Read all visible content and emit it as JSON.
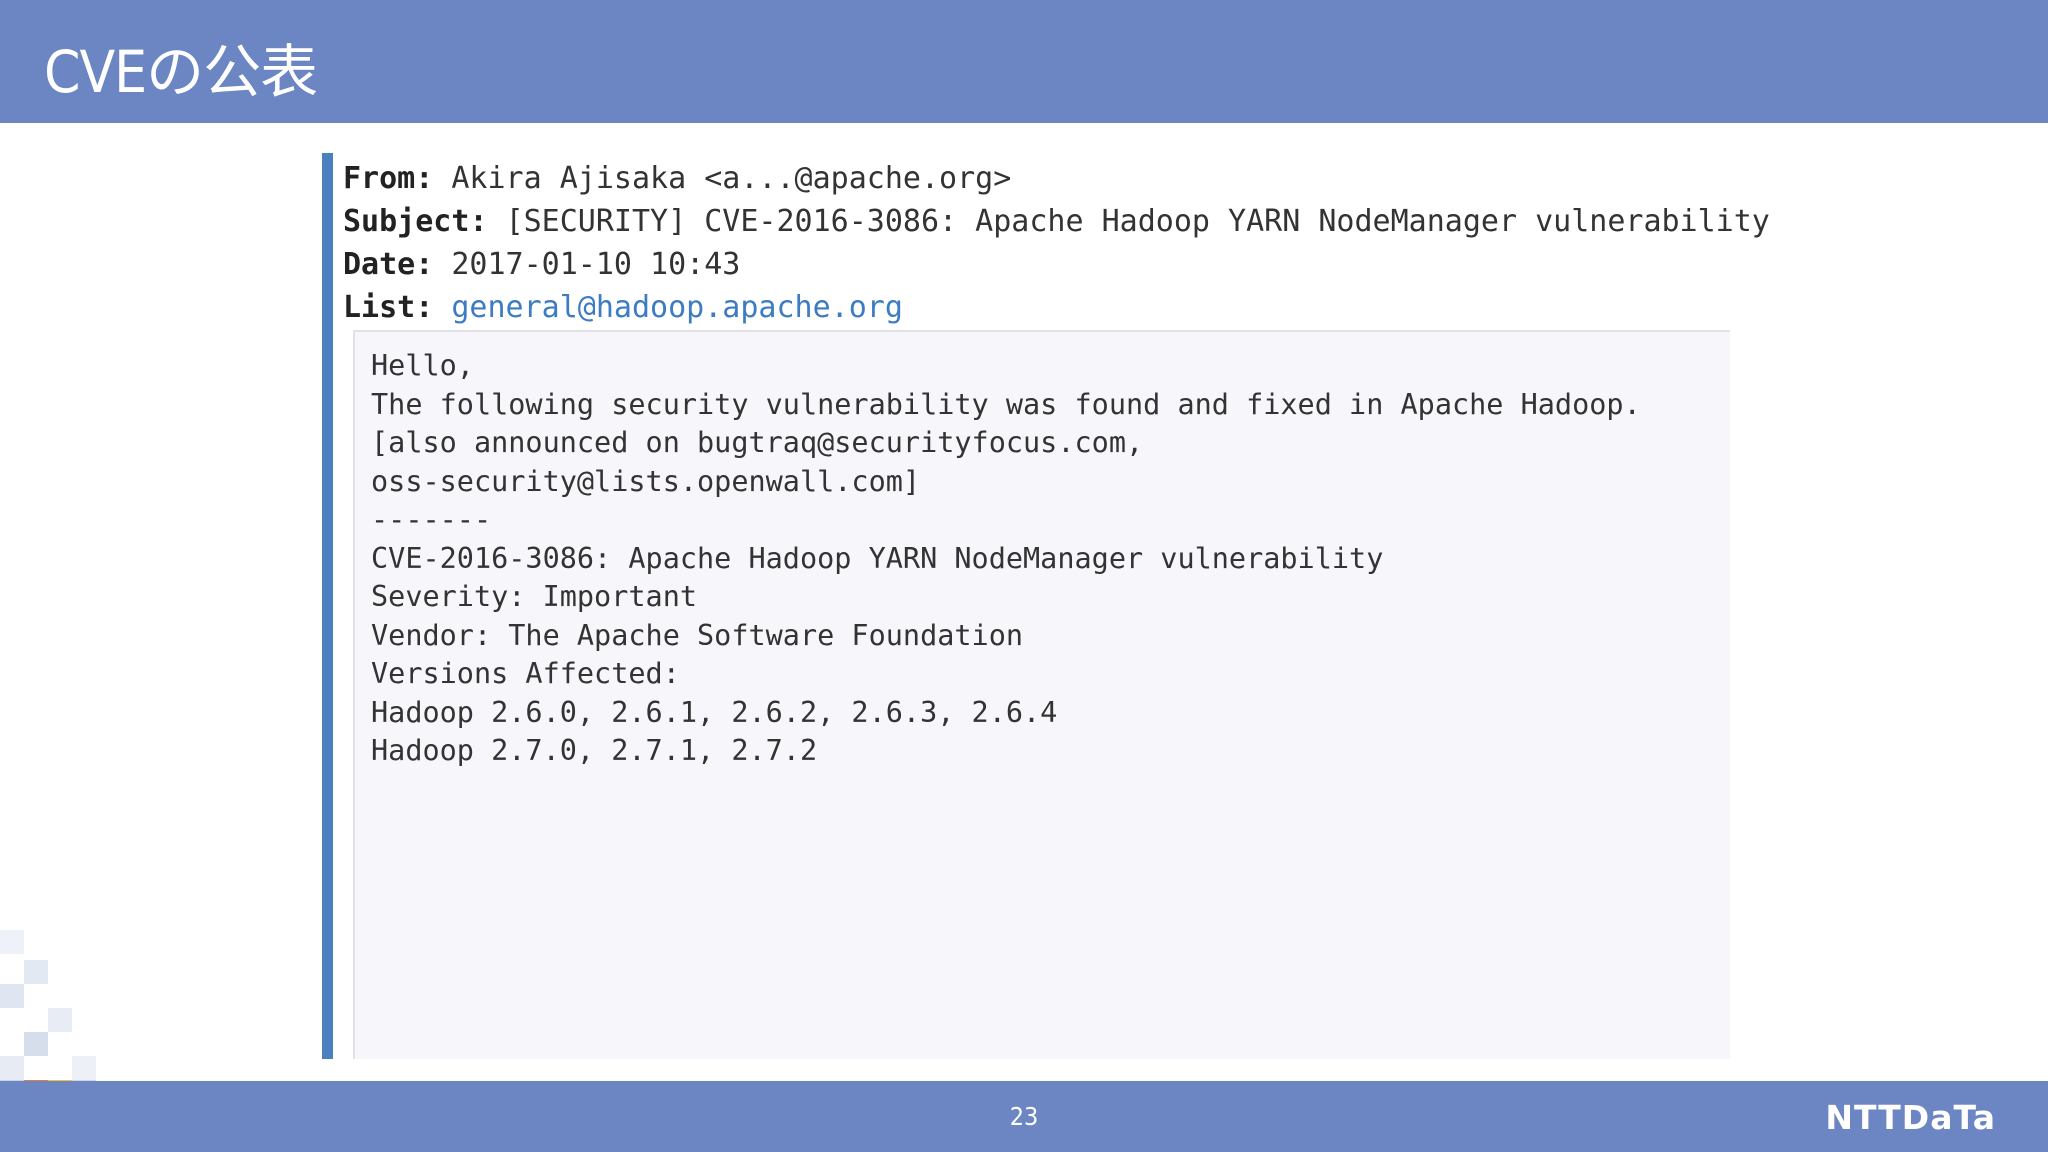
{
  "slide": {
    "title": "CVEの公表",
    "page_number": "23",
    "brand": "NTTDaTa"
  },
  "email": {
    "headers": [
      {
        "key": "From",
        "value": "Akira Ajisaka <a...@apache.org>",
        "link": false
      },
      {
        "key": "Subject",
        "value": "[SECURITY] CVE-2016-3086: Apache Hadoop YARN NodeManager vulnerability",
        "link": false
      },
      {
        "key": "Date",
        "value": "2017-01-10 10:43",
        "link": false
      },
      {
        "key": "List",
        "value": "general@hadoop.apache.org",
        "link": true
      }
    ],
    "body_lines": [
      "Hello,",
      "",
      "The following security vulnerability was found and fixed in Apache Hadoop.",
      "",
      "[also announced on bugtraq@securityfocus.com,",
      "oss-security@lists.openwall.com]",
      "",
      "-------",
      "",
      "CVE-2016-3086: Apache Hadoop YARN NodeManager vulnerability",
      "",
      "Severity: Important",
      "",
      "Vendor: The Apache Software Foundation",
      "",
      "Versions Affected:",
      "Hadoop 2.6.0, 2.6.1, 2.6.2, 2.6.3, 2.6.4",
      "Hadoop 2.7.0, 2.7.1, 2.7.2"
    ]
  },
  "colors": {
    "bar": "#6c86c3",
    "accent_line": "#4a7fc0",
    "link": "#3d7cc2",
    "body_background": "#f7f6fa"
  }
}
